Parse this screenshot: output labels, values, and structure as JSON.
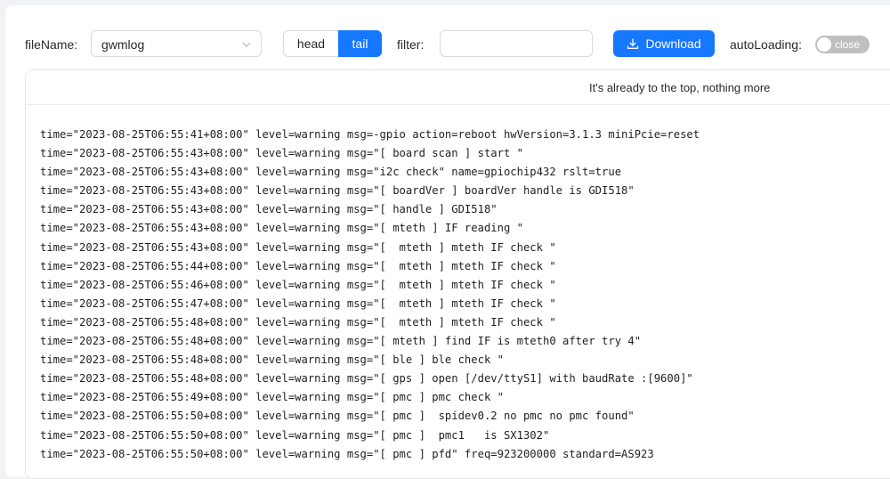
{
  "toolbar": {
    "file_name_label": "fileName",
    "file_name_value": "gwmlog",
    "mode_head": "head",
    "mode_tail": "tail",
    "selected_mode": "tail",
    "filter_label": "filter",
    "filter_value": "",
    "download_label": "Download",
    "auto_loading_label": "autoLoading",
    "auto_loading_state": "close",
    "accent_color": "#1677ff"
  },
  "log": {
    "top_message": "It's already to the top, nothing more",
    "lines": [
      "time=\"2023-08-25T06:55:41+08:00\" level=warning msg=-gpio action=reboot hwVersion=3.1.3 miniPcie=reset",
      "time=\"2023-08-25T06:55:43+08:00\" level=warning msg=\"[ board scan ] start \"",
      "time=\"2023-08-25T06:55:43+08:00\" level=warning msg=\"i2c check\" name=gpiochip432 rslt=true",
      "time=\"2023-08-25T06:55:43+08:00\" level=warning msg=\"[ boardVer ] boardVer handle is GDI518\"",
      "time=\"2023-08-25T06:55:43+08:00\" level=warning msg=\"[ handle ] GDI518\"",
      "time=\"2023-08-25T06:55:43+08:00\" level=warning msg=\"[ mteth ] IF reading \"",
      "time=\"2023-08-25T06:55:43+08:00\" level=warning msg=\"[  mteth ] mteth IF check \"",
      "time=\"2023-08-25T06:55:44+08:00\" level=warning msg=\"[  mteth ] mteth IF check \"",
      "time=\"2023-08-25T06:55:46+08:00\" level=warning msg=\"[  mteth ] mteth IF check \"",
      "time=\"2023-08-25T06:55:47+08:00\" level=warning msg=\"[  mteth ] mteth IF check \"",
      "time=\"2023-08-25T06:55:48+08:00\" level=warning msg=\"[  mteth ] mteth IF check \"",
      "time=\"2023-08-25T06:55:48+08:00\" level=warning msg=\"[ mteth ] find IF is mteth0 after try 4\"",
      "time=\"2023-08-25T06:55:48+08:00\" level=warning msg=\"[ ble ] ble check \"",
      "time=\"2023-08-25T06:55:48+08:00\" level=warning msg=\"[ gps ] open [/dev/ttyS1] with baudRate :[9600]\"",
      "time=\"2023-08-25T06:55:49+08:00\" level=warning msg=\"[ pmc ] pmc check \"",
      "time=\"2023-08-25T06:55:50+08:00\" level=warning msg=\"[ pmc ]  spidev0.2 no pmc no pmc found\"",
      "time=\"2023-08-25T06:55:50+08:00\" level=warning msg=\"[ pmc ]  pmc1   is SX1302\"",
      "time=\"2023-08-25T06:55:50+08:00\" level=warning msg=\"[ pmc ] pfd\" freq=923200000 standard=AS923"
    ]
  }
}
